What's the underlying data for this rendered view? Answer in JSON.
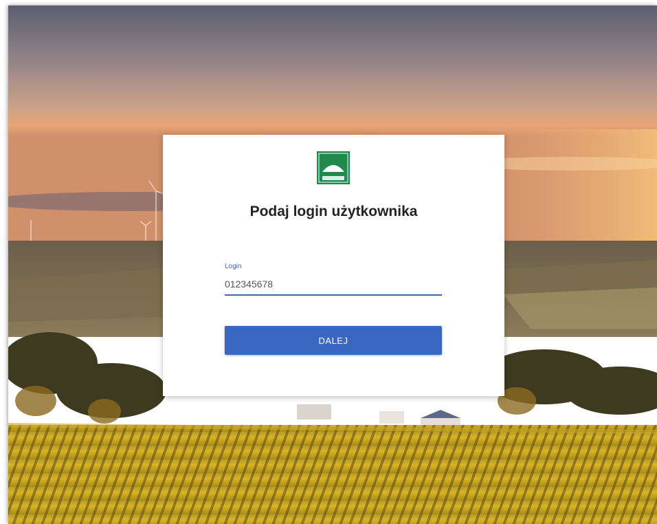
{
  "colors": {
    "accent": "#3a67c2",
    "logo_green": "#1f8a4c",
    "title": "#222222"
  },
  "login_card": {
    "logo_icon": "agency-logo-icon",
    "title": "Podaj login użytkownika",
    "login_field": {
      "label": "Login",
      "value": "012345678"
    },
    "next_button_label": "DALEJ"
  }
}
